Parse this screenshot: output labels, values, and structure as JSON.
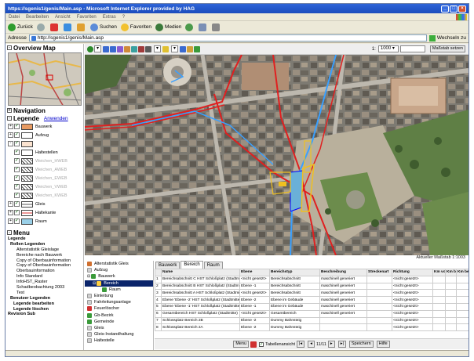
{
  "window": {
    "title": "https://sgenis1/genis/Main.asp - Microsoft Internet Explorer provided by HAG",
    "buttons": [
      "_",
      "□",
      "×"
    ]
  },
  "menubar": [
    "Datei",
    "Bearbeiten",
    "Ansicht",
    "Favoriten",
    "Extras",
    "?"
  ],
  "toolbar": {
    "back": "Zurück",
    "search": "Suchen",
    "favorites": "Favoriten",
    "media": "Medien"
  },
  "address": {
    "label": "Adresse",
    "url": "http://sgenis1/genis/Main.asp",
    "go": "Wechseln zu"
  },
  "left": {
    "overview_title": "Overview Map",
    "navigation_title": "Navigation",
    "legend_title": "Legende",
    "legend_apply": "Anwenden",
    "legend_items": [
      {
        "label": "Bauwerk",
        "color": "#e89b62",
        "dim": false
      },
      {
        "label": "Aufzug",
        "color": "#ffffff",
        "dim": false
      },
      {
        "label": "",
        "color": "#ffffff",
        "dim": false
      },
      {
        "label": "Haltestellen",
        "color": "#ffffff",
        "dim": false
      },
      {
        "label": "Weichen_HWEB",
        "color": "#ffffff",
        "dim": true
      },
      {
        "label": "Weichen_AWEB",
        "color": "#ffffff",
        "dim": true
      },
      {
        "label": "Weichen_EWEB",
        "color": "#ffffff",
        "dim": true
      },
      {
        "label": "Weichen_VWEB",
        "color": "#ffffff",
        "dim": true
      },
      {
        "label": "Weichen_KWEB",
        "color": "#ffffff",
        "dim": true
      },
      {
        "label": "Gleis",
        "color": "#ffffff",
        "dim": false
      },
      {
        "label": "Haltekante",
        "color": "#ffffff",
        "dim": false
      },
      {
        "label": "Raum",
        "color": "#9ad0e8",
        "dim": false
      }
    ],
    "menu_title": "Menu",
    "menu_items": [
      "Legende",
      "Rollen Legenden",
      "Alterstatistik Gleislage",
      "Bereiche nach Bauwerk",
      "Copy of Oberbauinformation",
      "Copy of Oberbauinformation",
      "Oberbauinformation",
      "Info Standard",
      "InfoHST_Raster",
      "Schadbeobachtung 2003",
      "Test",
      "Benutzer Legenden",
      "Legende bearbeiten",
      "Legende löschen",
      "Revision Sub"
    ]
  },
  "map": {
    "scale_value": "1000",
    "scale_button": "Maßstab setzen",
    "scale_label": "Aktueller Maßstab 1:1003"
  },
  "tree": [
    "Alterstatistik Gleis",
    "Aufzug",
    "Bauwerk",
    "Bereich",
    "Raum",
    "Einleitung",
    "Fahrleitungsanlage",
    "Feuerlöscher",
    "Gb-Bezirk",
    "Gemeinde",
    "Gleis",
    "Gleis-Instandhaltung",
    "Haltestelle"
  ],
  "grid": {
    "tabs": [
      "Bauwerk",
      "Bereich",
      "Raum"
    ],
    "columns": [
      "",
      "Name",
      "Ebene",
      "Bereichstyp",
      "Beschreibung",
      "Streckenart",
      "Richtung",
      "Km von",
      "Km bis",
      "Km beim"
    ],
    "rows": [
      [
        "1",
        "Bereichsabschnitt C HST Schloßplatz (Stadtmitte)",
        "<nicht gesetzt>",
        "Bereichsabschnitt",
        "maschinell generiert",
        "",
        "<nicht gesetzt>",
        "",
        "",
        ""
      ],
      [
        "2",
        "Bereichsabschnitt B HST Schloßplatz (Stadtmitte)",
        "Ebene -1",
        "Bereichsabschnitt",
        "maschinell generiert",
        "",
        "<nicht gesetzt>",
        "",
        "",
        ""
      ],
      [
        "3",
        "Bereichsabschnitt A HST Schloßplatz (Stadtmitte)",
        "<nicht gesetzt>",
        "Bereichsabschnitt",
        "maschinell generiert",
        "",
        "<nicht gesetzt>",
        "",
        "",
        ""
      ],
      [
        "4",
        "Ebene 'Ebene -2' HST Schloßplatz (Stadtmitte)",
        "Ebene -2",
        "Ebene im Gebäude",
        "maschinell generiert",
        "",
        "<nicht gesetzt>",
        "",
        "",
        ""
      ],
      [
        "5",
        "Ebene 'Ebene -1' HST Schloßplatz (Stadtmitte)",
        "Ebene -1",
        "Ebene im Gebäude",
        "maschinell generiert",
        "",
        "<nicht gesetzt>",
        "",
        "",
        ""
      ],
      [
        "6",
        "Gesamtbereich HST Schloßplatz (Stadtmitte)",
        "<nicht gesetzt>",
        "Gesamtbereich",
        "maschinell generiert",
        "",
        "<nicht gesetzt>",
        "",
        "",
        ""
      ],
      [
        "7",
        "Schlossplatz Bereich 2B",
        "Ebene -2",
        "Dummy Bahnsteig",
        "",
        "",
        "<nicht gesetzt>",
        "",
        "",
        ""
      ],
      [
        "8",
        "Schlossplatz Bereich 2A",
        "Ebene -2",
        "Dummy Bahnsteig",
        "",
        "",
        "<nicht gesetzt>",
        "",
        "",
        ""
      ]
    ],
    "bar": {
      "menu": "Menu",
      "table_view": "Tabellenansicht",
      "page": "11/11",
      "save": "Speichern",
      "help": "Hilfe"
    }
  }
}
